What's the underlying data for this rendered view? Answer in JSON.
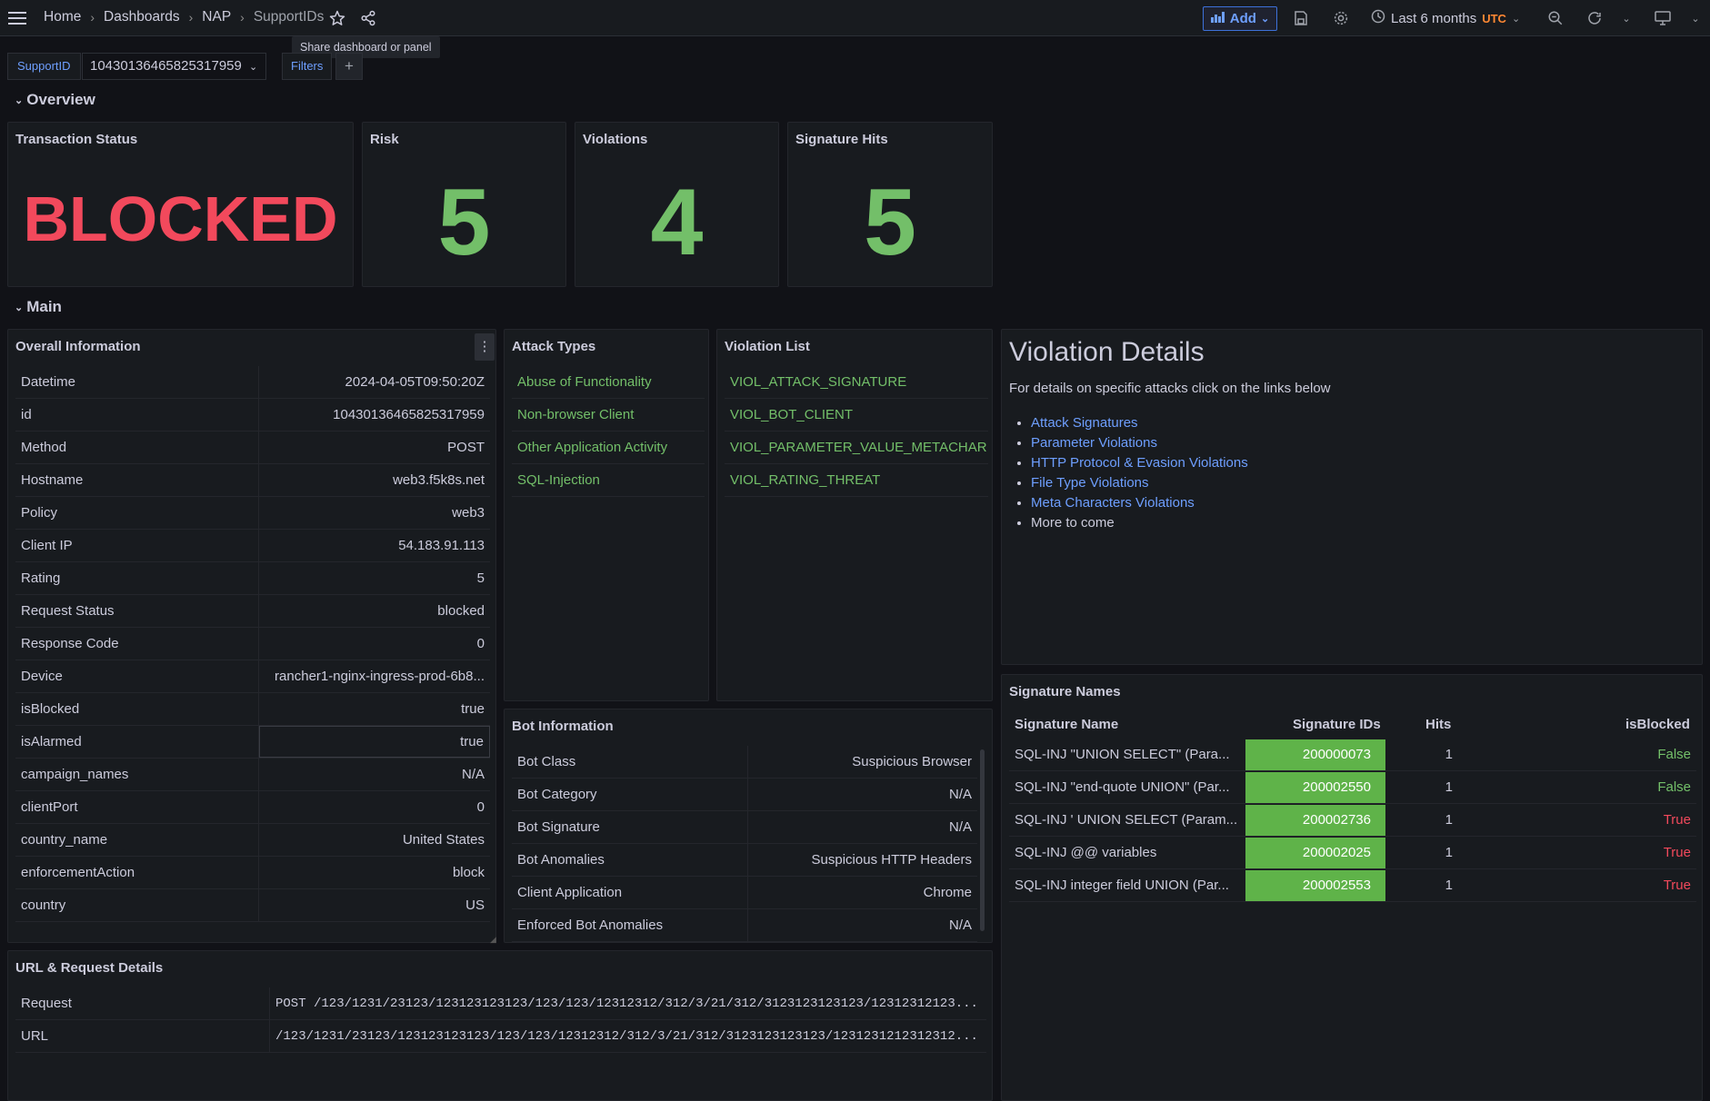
{
  "topbar": {
    "breadcrumbs": [
      "Home",
      "Dashboards",
      "NAP",
      "SupportIDs"
    ],
    "tooltip": "Share dashboard or panel",
    "add_label": "Add",
    "time_range": "Last 6 months",
    "timezone": "UTC"
  },
  "variables": {
    "support_label": "SupportID",
    "support_value": "10430136465825317959",
    "filters_label": "Filters",
    "add_filter": "+"
  },
  "rows": {
    "overview": "Overview",
    "main": "Main"
  },
  "stats": {
    "transaction": {
      "title": "Transaction Status",
      "value": "BLOCKED",
      "color": "#f2495c"
    },
    "risk": {
      "title": "Risk",
      "value": "5",
      "color": "#73bf69"
    },
    "violations": {
      "title": "Violations",
      "value": "4",
      "color": "#73bf69"
    },
    "sighits": {
      "title": "Signature Hits",
      "value": "5",
      "color": "#73bf69"
    }
  },
  "overall": {
    "title": "Overall Information",
    "rows": [
      {
        "k": "Datetime",
        "v": "2024-04-05T09:50:20Z"
      },
      {
        "k": "id",
        "v": "10430136465825317959"
      },
      {
        "k": "Method",
        "v": "POST"
      },
      {
        "k": "Hostname",
        "v": "web3.f5k8s.net"
      },
      {
        "k": "Policy",
        "v": "web3"
      },
      {
        "k": "Client IP",
        "v": "54.183.91.113"
      },
      {
        "k": "Rating",
        "v": "5"
      },
      {
        "k": "Request Status",
        "v": "blocked"
      },
      {
        "k": "Response Code",
        "v": "0"
      },
      {
        "k": "Device",
        "v": "rancher1-nginx-ingress-prod-6b8..."
      },
      {
        "k": "isBlocked",
        "v": "true"
      },
      {
        "k": "isAlarmed",
        "v": "true"
      },
      {
        "k": "campaign_names",
        "v": "N/A"
      },
      {
        "k": "clientPort",
        "v": "0"
      },
      {
        "k": "country_name",
        "v": "United States"
      },
      {
        "k": "enforcementAction",
        "v": "block"
      },
      {
        "k": "country",
        "v": "US"
      }
    ]
  },
  "attack_types": {
    "title": "Attack Types",
    "items": [
      "Abuse of Functionality",
      "Non-browser Client",
      "Other Application Activity",
      "SQL-Injection"
    ]
  },
  "violation_list": {
    "title": "Violation List",
    "items": [
      "VIOL_ATTACK_SIGNATURE",
      "VIOL_BOT_CLIENT",
      "VIOL_PARAMETER_VALUE_METACHAR",
      "VIOL_RATING_THREAT"
    ]
  },
  "violation_details": {
    "heading": "Violation Details",
    "intro": "For details on specific attacks click on the links below",
    "links": [
      "Attack Signatures",
      "Parameter Violations",
      "HTTP Protocol & Evasion Violations",
      "File Type Violations",
      "Meta Characters Violations"
    ],
    "more": "More to come"
  },
  "bot": {
    "title": "Bot Information",
    "rows": [
      {
        "k": "Bot Class",
        "v": "Suspicious Browser"
      },
      {
        "k": "Bot Category",
        "v": "N/A"
      },
      {
        "k": "Bot Signature",
        "v": "N/A"
      },
      {
        "k": "Bot Anomalies",
        "v": "Suspicious HTTP Headers"
      },
      {
        "k": "Client Application",
        "v": "Chrome"
      },
      {
        "k": "Enforced Bot Anomalies",
        "v": "N/A"
      }
    ]
  },
  "signatures": {
    "title": "Signature Names",
    "headers": [
      "Signature Name",
      "Signature IDs",
      "Hits",
      "isBlocked"
    ],
    "rows": [
      {
        "name": "SQL-INJ \"UNION SELECT\" (Para...",
        "id": "200000073",
        "hits": "1",
        "blocked": "False"
      },
      {
        "name": "SQL-INJ \"end-quote UNION\" (Par...",
        "id": "200002550",
        "hits": "1",
        "blocked": "False"
      },
      {
        "name": "SQL-INJ ' UNION SELECT (Param...",
        "id": "200002736",
        "hits": "1",
        "blocked": "True"
      },
      {
        "name": "SQL-INJ @@ variables",
        "id": "200002025",
        "hits": "1",
        "blocked": "True"
      },
      {
        "name": "SQL-INJ integer field UNION (Par...",
        "id": "200002553",
        "hits": "1",
        "blocked": "True"
      }
    ]
  },
  "url_details": {
    "title": "URL & Request Details",
    "rows": [
      {
        "k": "Request",
        "v": "POST /123/1231/23123/123123123123/123/123/12312312/312/3/21/312/3123123123123/12312312123..."
      },
      {
        "k": "URL",
        "v": "/123/1231/23123/123123123123/123/123/12312312/312/3/21/312/3123123123123/1231231212312312..."
      }
    ]
  },
  "colors": {
    "green": "#73bf69",
    "red": "#f2495c",
    "blue_link": "#6e9fff",
    "cell_green": "#5fb349"
  }
}
